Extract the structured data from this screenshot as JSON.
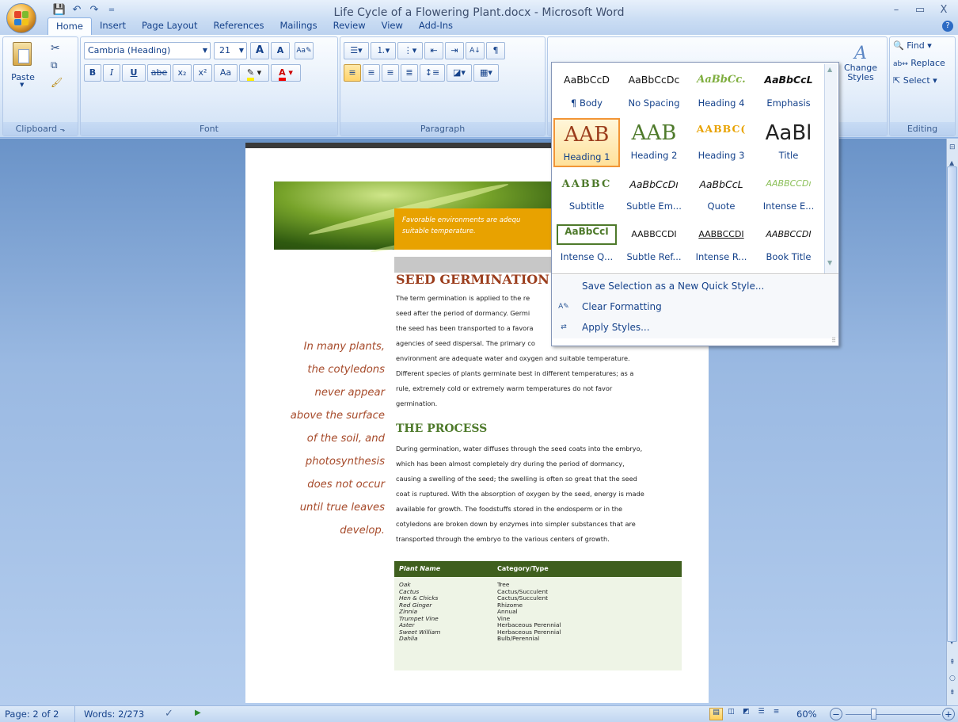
{
  "window": {
    "title": "Life Cycle of a Flowering Plant.docx - Microsoft Word",
    "min": "–",
    "restore": "▭",
    "close": "X"
  },
  "qat": {
    "save_icon": "save-icon",
    "undo_icon": "undo-icon",
    "redo_icon": "redo-icon",
    "sep": "="
  },
  "tabs": [
    "Home",
    "Insert",
    "Page Layout",
    "References",
    "Mailings",
    "Review",
    "View",
    "Add-Ins"
  ],
  "help": "?",
  "ribbon": {
    "clipboard": {
      "label": "Clipboard",
      "paste": "Paste"
    },
    "font": {
      "label": "Font",
      "name": "Cambria (Heading)",
      "size": "21",
      "bold": "B",
      "italic": "I",
      "underline": "U",
      "strike": "abe",
      "sub": "x₂",
      "sup": "x²",
      "grow": "A",
      "shrink": "A",
      "clear": "Aa"
    },
    "paragraph": {
      "label": "Paragraph",
      "pilcrow": "¶",
      "sort": "A↓"
    },
    "styles": {
      "change": "Change Styles"
    },
    "editing": {
      "label": "Editing",
      "find": "Find",
      "replace": "Replace",
      "select": "Select"
    }
  },
  "gallery": {
    "rows": [
      [
        {
          "sample": "AaBbCcD",
          "label": "¶ Body"
        },
        {
          "sample": "AaBbCcDc",
          "label": "No Spacing"
        },
        {
          "sample": "AaBbCc.",
          "label": "Heading 4"
        },
        {
          "sample": "AaBbCcL",
          "label": "Emphasis"
        }
      ],
      [
        {
          "sample": "AAB",
          "label": "Heading 1"
        },
        {
          "sample": "AAB",
          "label": "Heading 2"
        },
        {
          "sample": "AABBC(",
          "label": "Heading 3"
        },
        {
          "sample": "AaBl",
          "label": "Title"
        }
      ],
      [
        {
          "sample": "AABBC",
          "label": "Subtitle"
        },
        {
          "sample": "AaBbCcDı",
          "label": "Subtle Em..."
        },
        {
          "sample": "AaBbCcL",
          "label": "Quote"
        },
        {
          "sample": "AABBCCDı",
          "label": "Intense E..."
        }
      ],
      [
        {
          "sample": "AaBbCcI",
          "label": "Intense Q..."
        },
        {
          "sample": "AABBCCDI",
          "label": "Subtle Ref..."
        },
        {
          "sample": "AABBCCDI",
          "label": "Intense R..."
        },
        {
          "sample": "AABBCCDI",
          "label": "Book Title"
        }
      ]
    ],
    "menu": [
      {
        "icon": "new-style-icon",
        "text": "Save Selection as a New Quick Style..."
      },
      {
        "icon": "clear-formatting-icon",
        "text": "Clear Formatting"
      },
      {
        "icon": "apply-styles-icon",
        "text": "Apply Styles..."
      }
    ]
  },
  "document": {
    "banner": "Favorable environments are adequ suitable temperature.",
    "h1": "SEED GERMINATION",
    "p1": [
      "The term germination is applied to the re",
      "seed after the period of dormancy. Germi",
      "the seed has been transported to a favora",
      "agencies of seed dispersal. The primary co",
      "environment are adequate water and oxygen and suitable temperature.",
      "Different species of plants germinate best in different temperatures; as a",
      "rule, extremely cold or extremely warm temperatures do not favor",
      "germination."
    ],
    "h2": "THE PROCESS",
    "p2": [
      "During germination, water diffuses through the seed coats into the embryo,",
      "which has been almost completely dry during the period of dormancy,",
      "causing a swelling of the seed; the swelling is often so great that the seed",
      "coat is ruptured. With the absorption of oxygen by the seed, energy is made",
      "available for growth. The foodstuffs stored in the endosperm or in the",
      "cotyledons are broken down by enzymes into simpler substances that are",
      "transported through the embryo to the various centers of growth."
    ],
    "pullquote": [
      "In many plants,",
      "the cotyledons",
      "never appear",
      "above the surface",
      "of the soil, and",
      "photosynthesis",
      "does not occur",
      "until true leaves",
      "develop."
    ],
    "table": {
      "headers": [
        "Plant Name",
        "Category/Type"
      ],
      "rows": [
        [
          "Oak",
          "Tree"
        ],
        [
          "Cactus",
          "Cactus/Succulent"
        ],
        [
          "Hen & Chicks",
          "Cactus/Succulent"
        ],
        [
          "Red Ginger",
          "Rhizome"
        ],
        [
          "Zinnia",
          "Annual"
        ],
        [
          "Trumpet Vine",
          "Vine"
        ],
        [
          "Aster",
          "Herbaceous Perennial"
        ],
        [
          "Sweet William",
          "Herbaceous Perennial"
        ],
        [
          "Dahlia",
          "Bulb/Perennial"
        ]
      ]
    }
  },
  "status": {
    "page": "Page: 2 of 2",
    "words": "Words: 2/273",
    "zoom": "60%",
    "zoom_out": "−",
    "zoom_in": "+"
  },
  "colors": {
    "heading_brown": "#9b3d1c",
    "green_heading": "#4e7a2b",
    "table_header": "#3f5f1e",
    "banner_orange": "#e8a200",
    "pullquote": "#a64a2a"
  }
}
